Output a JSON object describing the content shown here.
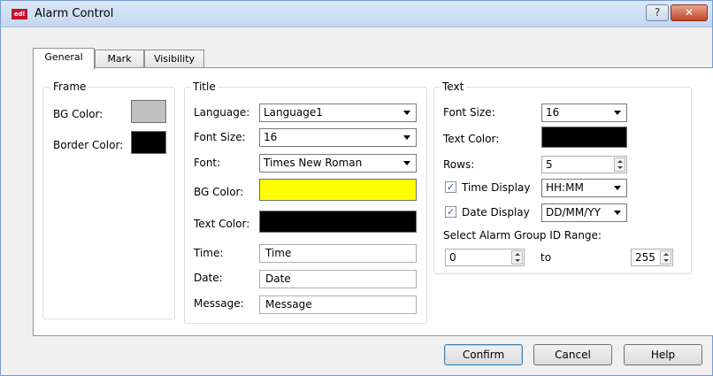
{
  "window": {
    "title": "Alarm Control",
    "icon": "app-logo-icon",
    "help_symbol": "?",
    "close_symbol": "✕"
  },
  "tabs": [
    {
      "label": "General"
    },
    {
      "label": "Mark"
    },
    {
      "label": "Visibility"
    }
  ],
  "frame": {
    "legend": "Frame",
    "bg_color_label": "BG Color:",
    "border_color_label": "Border Color:",
    "bg_color": "#c0c0c0",
    "border_color": "#000000"
  },
  "title_group": {
    "legend": "Title",
    "language_label": "Language:",
    "language_value": "Language1",
    "font_size_label": "Font Size:",
    "font_size_value": "16",
    "font_label": "Font:",
    "font_value": "Times New Roman",
    "bg_color_label": "BG Color:",
    "bg_color": "#ffff00",
    "text_color_label": "Text Color:",
    "text_color": "#000000",
    "time_label": "Time:",
    "time_value": "Time",
    "date_label": "Date:",
    "date_value": "Date",
    "message_label": "Message:",
    "message_value": "Message"
  },
  "text_group": {
    "legend": "Text",
    "font_size_label": "Font Size:",
    "font_size_value": "16",
    "text_color_label": "Text Color:",
    "text_color": "#000000",
    "rows_label": "Rows:",
    "rows_value": "5",
    "time_display_label": "Time Display",
    "time_display_checked": true,
    "time_format": "HH:MM",
    "date_display_label": "Date Display",
    "date_display_checked": true,
    "date_format": "DD/MM/YY",
    "range_label": "Select Alarm Group ID Range:",
    "range_from": "0",
    "range_to_label": "to",
    "range_to": "255"
  },
  "buttons": {
    "confirm": "Confirm",
    "cancel": "Cancel",
    "help": "Help"
  }
}
